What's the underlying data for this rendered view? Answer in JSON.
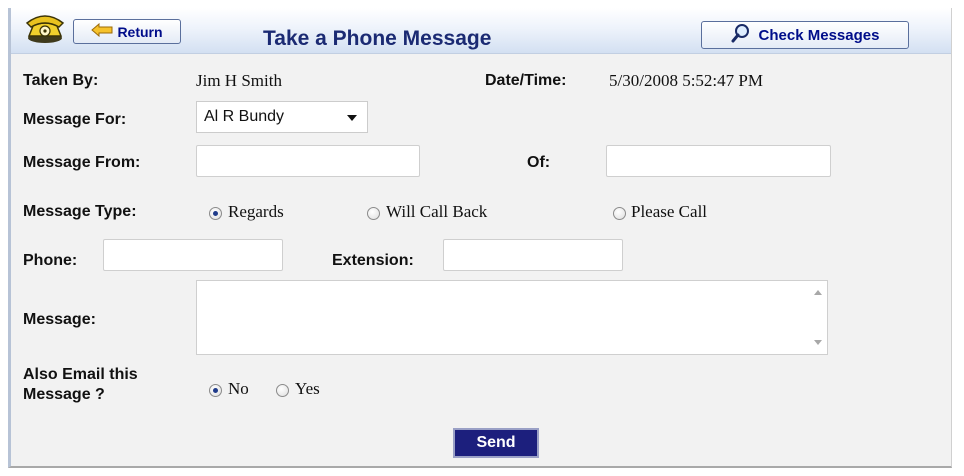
{
  "header": {
    "title": "Take a Phone Message",
    "return_label": "Return",
    "check_messages_label": "Check Messages"
  },
  "form": {
    "taken_by_label": "Taken By:",
    "taken_by_value": "Jim H Smith",
    "datetime_label": "Date/Time:",
    "datetime_value": "5/30/2008 5:52:47 PM",
    "message_for_label": "Message For:",
    "message_for_selected": "Al R Bundy",
    "message_from_label": "Message From:",
    "message_from_value": "",
    "of_label": "Of:",
    "of_value": "",
    "message_type_label": "Message Type:",
    "message_type_options": [
      "Regards",
      "Will Call Back",
      "Please Call"
    ],
    "message_type_selected": "Regards",
    "phone_label": "Phone:",
    "phone_value": "",
    "extension_label": "Extension:",
    "extension_value": "",
    "message_label": "Message:",
    "message_value": "",
    "email_label_line1": "Also Email this",
    "email_label_line2": "Message ?",
    "email_options": [
      "No",
      "Yes"
    ],
    "email_selected": "No",
    "send_label": "Send"
  },
  "icons": {
    "phone": "telephone-icon",
    "return": "left-arrow-icon",
    "check": "magnifier-icon"
  },
  "colors": {
    "title": "#1b2a73",
    "button_text": "#000d8a",
    "send_bg": "#1c1f7d",
    "panel_bg": "#f2f2f2"
  }
}
